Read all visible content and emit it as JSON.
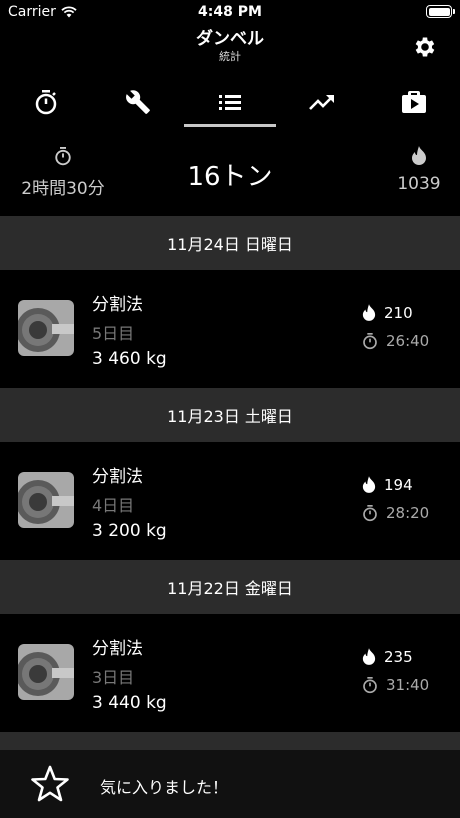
{
  "status_bar": {
    "carrier": "Carrier",
    "time": "4:48 PM"
  },
  "nav": {
    "title": "ダンベル",
    "subtitle": "統計"
  },
  "tabs": [
    {
      "icon": "stopwatch-icon",
      "selected": false
    },
    {
      "icon": "wrench-icon",
      "selected": false
    },
    {
      "icon": "list-icon",
      "selected": true
    },
    {
      "icon": "trend-icon",
      "selected": false
    },
    {
      "icon": "video-icon",
      "selected": false
    }
  ],
  "summary": {
    "duration": "2時間30分",
    "total_weight": "16トン",
    "calories": "1039"
  },
  "sessions": [
    {
      "date": "11月24日 日曜日",
      "name": "分割法",
      "day": "5日目",
      "weight": "3 460 kg",
      "calories": "210",
      "duration": "26:40"
    },
    {
      "date": "11月23日 土曜日",
      "name": "分割法",
      "day": "4日目",
      "weight": "3 200 kg",
      "calories": "194",
      "duration": "28:20"
    },
    {
      "date": "11月22日 金曜日",
      "name": "分割法",
      "day": "3日目",
      "weight": "3 440 kg",
      "calories": "235",
      "duration": "31:40"
    }
  ],
  "footer": {
    "label": "気に入りました！",
    "icon": "star-icon"
  },
  "colors": {
    "background": "#000000",
    "section_header": "#2c2c2c",
    "muted": "#777777",
    "indicator": "#c8c8c8"
  }
}
